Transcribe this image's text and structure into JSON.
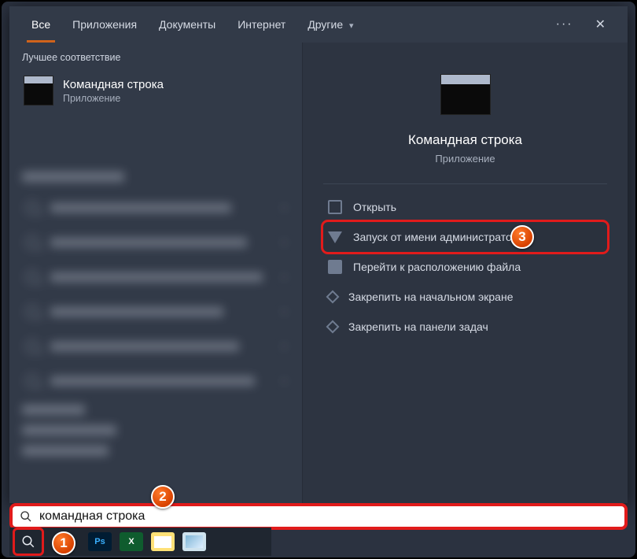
{
  "tabs": {
    "all": "Все",
    "apps": "Приложения",
    "docs": "Документы",
    "internet": "Интернет",
    "other": "Другие"
  },
  "left": {
    "best_match_label": "Лучшее соответствие",
    "best_match_title": "Командная строка",
    "best_match_sub": "Приложение"
  },
  "right": {
    "title": "Командная строка",
    "sub": "Приложение",
    "actions": {
      "open": "Открыть",
      "run_admin": "Запуск от имени администратора",
      "goto_location": "Перейти к расположению файла",
      "pin_start": "Закрепить на начальном экране",
      "pin_taskbar": "Закрепить на панели задач"
    }
  },
  "search": {
    "query": "командная строка"
  },
  "taskbar": {
    "ps": "Ps",
    "xl": "X"
  },
  "badges": {
    "one": "1",
    "two": "2",
    "three": "3"
  }
}
